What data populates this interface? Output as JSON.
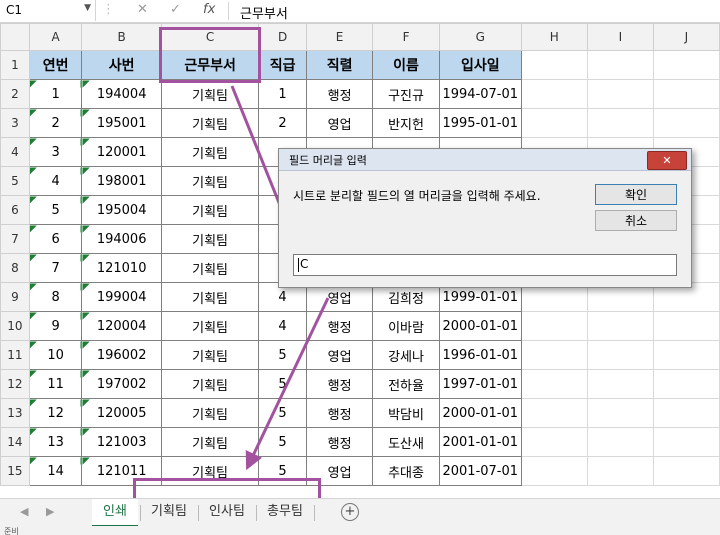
{
  "formula_bar": {
    "name_box": "C1",
    "cancel": "✕",
    "enter": "✓",
    "fx": "fx",
    "value": "근무부서"
  },
  "sheet": {
    "columns": [
      "A",
      "B",
      "C",
      "D",
      "E",
      "F",
      "G",
      "H",
      "I",
      "J"
    ],
    "selected_column": "C",
    "rows": [
      "1",
      "2",
      "3",
      "4",
      "5",
      "6",
      "7",
      "8",
      "9",
      "10",
      "11",
      "12",
      "13",
      "14",
      "15"
    ],
    "headers": [
      "연번",
      "사번",
      "근무부서",
      "직급",
      "직렬",
      "이름",
      "입사일"
    ],
    "data": [
      [
        "1",
        "194004",
        "기획팀",
        "1",
        "행정",
        "구진규",
        "1994-07-01"
      ],
      [
        "2",
        "195001",
        "기획팀",
        "2",
        "영업",
        "반지헌",
        "1995-01-01"
      ],
      [
        "3",
        "120001",
        "기획팀",
        "",
        "",
        "",
        ""
      ],
      [
        "4",
        "198001",
        "기획팀",
        "",
        "",
        "",
        ""
      ],
      [
        "5",
        "195004",
        "기획팀",
        "",
        "",
        "",
        ""
      ],
      [
        "6",
        "194006",
        "기획팀",
        "",
        "",
        "",
        ""
      ],
      [
        "7",
        "121010",
        "기획팀",
        "",
        "",
        "",
        ""
      ],
      [
        "8",
        "199004",
        "기획팀",
        "4",
        "영업",
        "김희정",
        "1999-01-01"
      ],
      [
        "9",
        "120004",
        "기획팀",
        "4",
        "행정",
        "이바람",
        "2000-01-01"
      ],
      [
        "10",
        "196002",
        "기획팀",
        "5",
        "영업",
        "강세나",
        "1996-01-01"
      ],
      [
        "11",
        "197002",
        "기획팀",
        "5",
        "행정",
        "전하율",
        "1997-01-01"
      ],
      [
        "12",
        "120005",
        "기획팀",
        "5",
        "행정",
        "박담비",
        "2000-01-01"
      ],
      [
        "13",
        "121003",
        "기획팀",
        "5",
        "행정",
        "도산새",
        "2001-01-01"
      ],
      [
        "14",
        "121011",
        "기획팀",
        "5",
        "영업",
        "추대종",
        "2001-07-01"
      ]
    ]
  },
  "dialog": {
    "title": "필드 머리글 입력",
    "close": "✕",
    "message": "시트로 분리할 필드의 열 머리글을 입력해 주세요.",
    "ok": "확인",
    "cancel": "취소",
    "input_value": "C"
  },
  "tabs": {
    "prev": "◀",
    "next": "▶",
    "items": [
      "인쇄",
      "기획팀",
      "인사팀",
      "총무팀"
    ],
    "active": "인쇄",
    "add": "+"
  },
  "status_bar": {
    "text": "준비"
  },
  "colors": {
    "accent": "#a352a0",
    "header_fill": "#bdd7ee",
    "excel_green": "#217346"
  }
}
